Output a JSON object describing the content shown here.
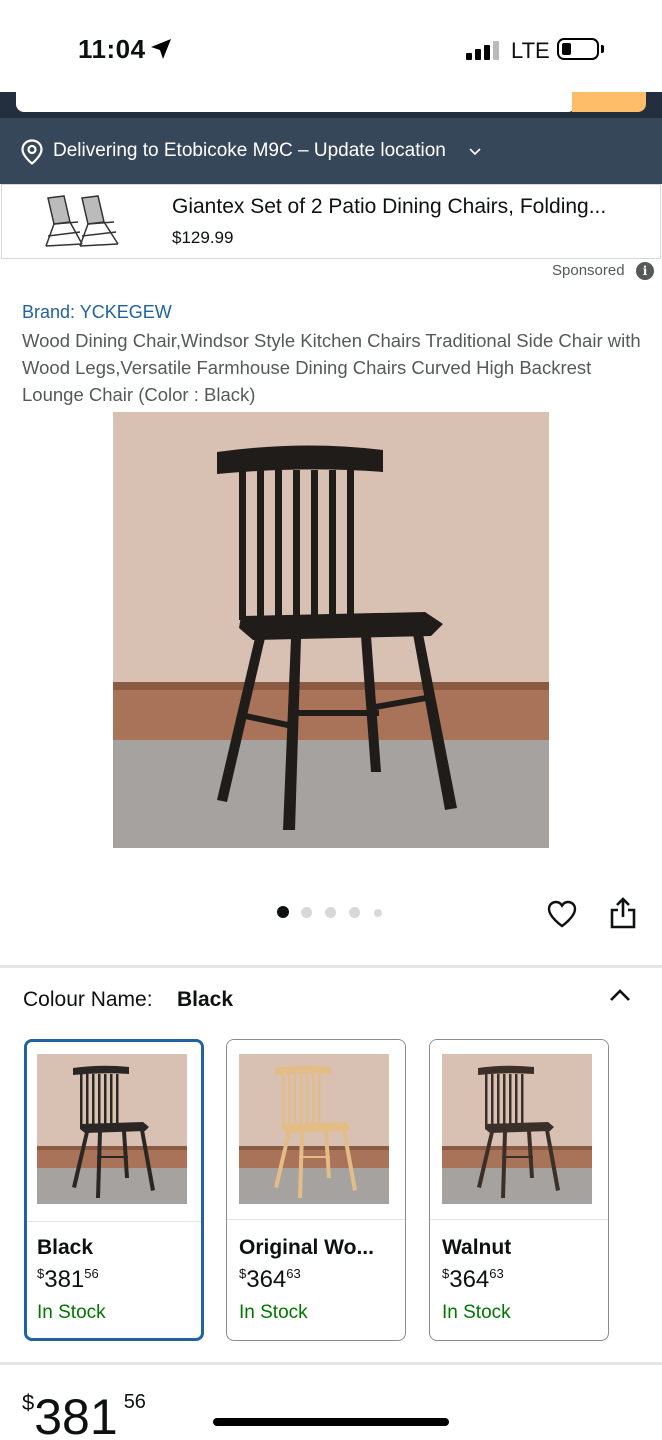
{
  "status_bar": {
    "time": "11:04",
    "network": "LTE"
  },
  "delivery": {
    "text": "Delivering to Etobicoke M9C – Update location",
    "icon": "location-pin-icon"
  },
  "sponsored_ad": {
    "title": "Giantex Set of 2 Patio Dining Chairs, Folding...",
    "price": "$129.99",
    "sponsored_label": "Sponsored",
    "info_glyph": "i"
  },
  "product": {
    "brand": "Brand: YCKEGEW",
    "title": "Wood Dining Chair,Windsor Style Kitchen Chairs Traditional Side Chair with Wood Legs,Versatile Farmhouse Dining Chairs Curved High Backrest Lounge Chair (Color : Black)"
  },
  "carousel": {
    "total_images": 5,
    "active_index": 0
  },
  "colour": {
    "label": "Colour Name:",
    "selected": "Black",
    "options": [
      {
        "name": "Black",
        "price_symbol": "$",
        "price_whole": "381",
        "price_cents": "56",
        "stock": "In Stock",
        "chair_color": "#2a2624",
        "selected": true
      },
      {
        "name": "Original Wo...",
        "price_symbol": "$",
        "price_whole": "364",
        "price_cents": "63",
        "stock": "In Stock",
        "chair_color": "#e3bd86",
        "selected": false
      },
      {
        "name": "Walnut",
        "price_symbol": "$",
        "price_whole": "364",
        "price_cents": "63",
        "stock": "In Stock",
        "chair_color": "#3b2f2a",
        "selected": false
      }
    ]
  },
  "bottom_price": {
    "symbol": "$",
    "whole": "381",
    "cents": "56"
  },
  "colors": {
    "delivery_bar": "#37475a",
    "link": "#2162a1",
    "in_stock": "#007600",
    "selected_border": "#2162a1"
  }
}
